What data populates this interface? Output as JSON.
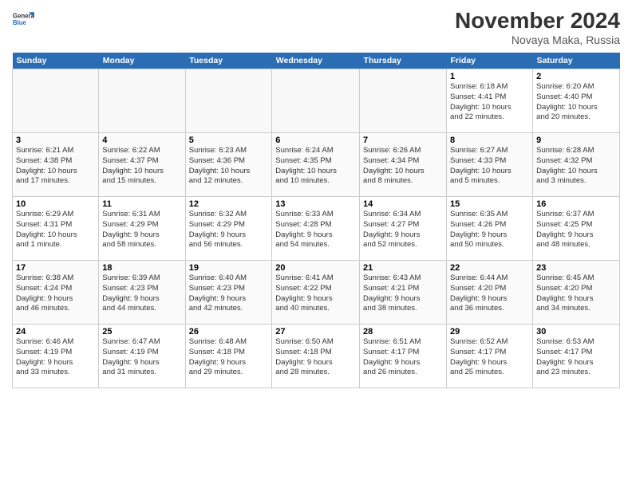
{
  "logo": {
    "line1": "General",
    "line2": "Blue"
  },
  "title": "November 2024",
  "subtitle": "Novaya Maka, Russia",
  "days_of_week": [
    "Sunday",
    "Monday",
    "Tuesday",
    "Wednesday",
    "Thursday",
    "Friday",
    "Saturday"
  ],
  "weeks": [
    [
      {
        "day": "",
        "info": ""
      },
      {
        "day": "",
        "info": ""
      },
      {
        "day": "",
        "info": ""
      },
      {
        "day": "",
        "info": ""
      },
      {
        "day": "",
        "info": ""
      },
      {
        "day": "1",
        "info": "Sunrise: 6:18 AM\nSunset: 4:41 PM\nDaylight: 10 hours\nand 22 minutes."
      },
      {
        "day": "2",
        "info": "Sunrise: 6:20 AM\nSunset: 4:40 PM\nDaylight: 10 hours\nand 20 minutes."
      }
    ],
    [
      {
        "day": "3",
        "info": "Sunrise: 6:21 AM\nSunset: 4:38 PM\nDaylight: 10 hours\nand 17 minutes."
      },
      {
        "day": "4",
        "info": "Sunrise: 6:22 AM\nSunset: 4:37 PM\nDaylight: 10 hours\nand 15 minutes."
      },
      {
        "day": "5",
        "info": "Sunrise: 6:23 AM\nSunset: 4:36 PM\nDaylight: 10 hours\nand 12 minutes."
      },
      {
        "day": "6",
        "info": "Sunrise: 6:24 AM\nSunset: 4:35 PM\nDaylight: 10 hours\nand 10 minutes."
      },
      {
        "day": "7",
        "info": "Sunrise: 6:26 AM\nSunset: 4:34 PM\nDaylight: 10 hours\nand 8 minutes."
      },
      {
        "day": "8",
        "info": "Sunrise: 6:27 AM\nSunset: 4:33 PM\nDaylight: 10 hours\nand 5 minutes."
      },
      {
        "day": "9",
        "info": "Sunrise: 6:28 AM\nSunset: 4:32 PM\nDaylight: 10 hours\nand 3 minutes."
      }
    ],
    [
      {
        "day": "10",
        "info": "Sunrise: 6:29 AM\nSunset: 4:31 PM\nDaylight: 10 hours\nand 1 minute."
      },
      {
        "day": "11",
        "info": "Sunrise: 6:31 AM\nSunset: 4:29 PM\nDaylight: 9 hours\nand 58 minutes."
      },
      {
        "day": "12",
        "info": "Sunrise: 6:32 AM\nSunset: 4:29 PM\nDaylight: 9 hours\nand 56 minutes."
      },
      {
        "day": "13",
        "info": "Sunrise: 6:33 AM\nSunset: 4:28 PM\nDaylight: 9 hours\nand 54 minutes."
      },
      {
        "day": "14",
        "info": "Sunrise: 6:34 AM\nSunset: 4:27 PM\nDaylight: 9 hours\nand 52 minutes."
      },
      {
        "day": "15",
        "info": "Sunrise: 6:35 AM\nSunset: 4:26 PM\nDaylight: 9 hours\nand 50 minutes."
      },
      {
        "day": "16",
        "info": "Sunrise: 6:37 AM\nSunset: 4:25 PM\nDaylight: 9 hours\nand 48 minutes."
      }
    ],
    [
      {
        "day": "17",
        "info": "Sunrise: 6:38 AM\nSunset: 4:24 PM\nDaylight: 9 hours\nand 46 minutes."
      },
      {
        "day": "18",
        "info": "Sunrise: 6:39 AM\nSunset: 4:23 PM\nDaylight: 9 hours\nand 44 minutes."
      },
      {
        "day": "19",
        "info": "Sunrise: 6:40 AM\nSunset: 4:23 PM\nDaylight: 9 hours\nand 42 minutes."
      },
      {
        "day": "20",
        "info": "Sunrise: 6:41 AM\nSunset: 4:22 PM\nDaylight: 9 hours\nand 40 minutes."
      },
      {
        "day": "21",
        "info": "Sunrise: 6:43 AM\nSunset: 4:21 PM\nDaylight: 9 hours\nand 38 minutes."
      },
      {
        "day": "22",
        "info": "Sunrise: 6:44 AM\nSunset: 4:20 PM\nDaylight: 9 hours\nand 36 minutes."
      },
      {
        "day": "23",
        "info": "Sunrise: 6:45 AM\nSunset: 4:20 PM\nDaylight: 9 hours\nand 34 minutes."
      }
    ],
    [
      {
        "day": "24",
        "info": "Sunrise: 6:46 AM\nSunset: 4:19 PM\nDaylight: 9 hours\nand 33 minutes."
      },
      {
        "day": "25",
        "info": "Sunrise: 6:47 AM\nSunset: 4:19 PM\nDaylight: 9 hours\nand 31 minutes."
      },
      {
        "day": "26",
        "info": "Sunrise: 6:48 AM\nSunset: 4:18 PM\nDaylight: 9 hours\nand 29 minutes."
      },
      {
        "day": "27",
        "info": "Sunrise: 6:50 AM\nSunset: 4:18 PM\nDaylight: 9 hours\nand 28 minutes."
      },
      {
        "day": "28",
        "info": "Sunrise: 6:51 AM\nSunset: 4:17 PM\nDaylight: 9 hours\nand 26 minutes."
      },
      {
        "day": "29",
        "info": "Sunrise: 6:52 AM\nSunset: 4:17 PM\nDaylight: 9 hours\nand 25 minutes."
      },
      {
        "day": "30",
        "info": "Sunrise: 6:53 AM\nSunset: 4:17 PM\nDaylight: 9 hours\nand 23 minutes."
      }
    ]
  ]
}
